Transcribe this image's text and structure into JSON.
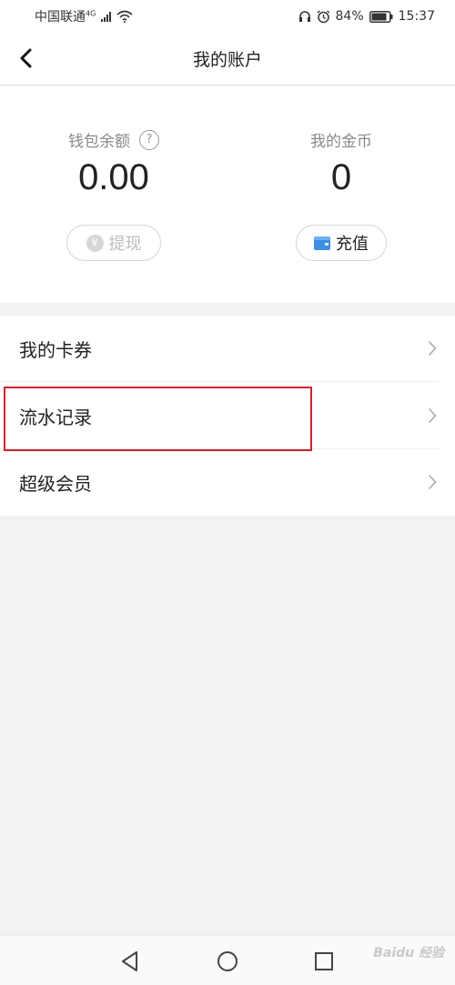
{
  "status_bar": {
    "carrier": "中国联通",
    "network": "4G",
    "battery": "84%",
    "time": "15:37"
  },
  "header": {
    "title": "我的账户",
    "back_icon": "chevron-left-icon"
  },
  "wallet": {
    "label": "钱包余额",
    "help_glyph": "?",
    "value": "0.00",
    "withdraw_label": "提现",
    "withdraw_icon": "yen-icon",
    "withdraw_enabled": false
  },
  "coins": {
    "label": "我的金币",
    "value": "0",
    "recharge_label": "充值",
    "recharge_icon": "wallet-icon"
  },
  "menu": {
    "items": [
      {
        "label": "我的卡券"
      },
      {
        "label": "流水记录"
      },
      {
        "label": "超级会员"
      }
    ]
  },
  "watermark": "Baidu 经验",
  "colors": {
    "background": "#f2f2f2",
    "card": "#ffffff",
    "highlight": "#c8242f",
    "wallet_icon": "#3d8ee6",
    "disabled": "#bdbdbd"
  }
}
